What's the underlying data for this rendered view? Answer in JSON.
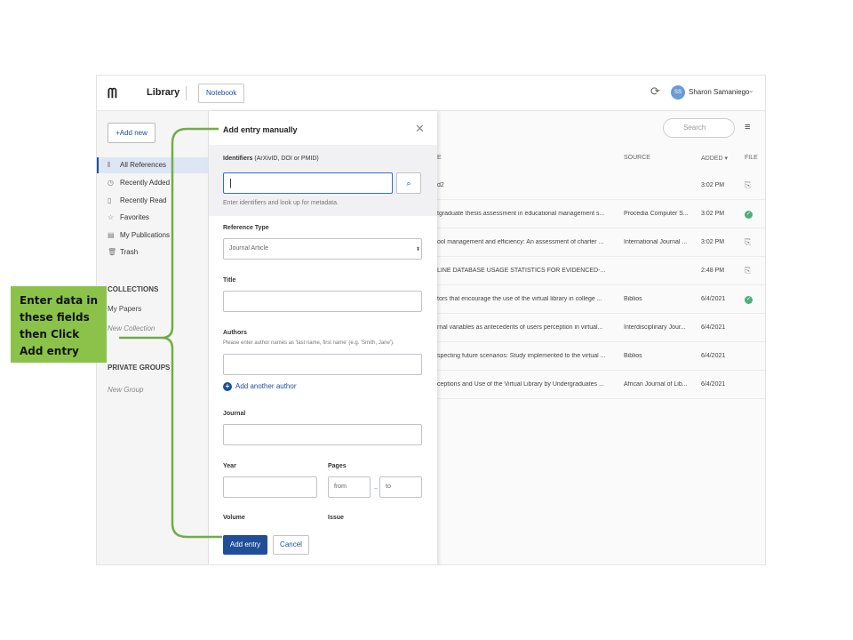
{
  "topbar": {
    "logo": "ᗰ",
    "title": "Library",
    "notebook_label": "Notebook",
    "avatar_initials": "SS",
    "user_name": "Sharon Samaniego"
  },
  "sidebar": {
    "add_new_label": "+Add new",
    "items": [
      {
        "icon": "all-references-icon",
        "glyph": "⫴",
        "label": "All References"
      },
      {
        "icon": "clock-icon",
        "glyph": "◷",
        "label": "Recently Added"
      },
      {
        "icon": "bookmark-icon",
        "glyph": "▯",
        "label": "Recently Read"
      },
      {
        "icon": "star-icon",
        "glyph": "☆",
        "label": "Favorites"
      },
      {
        "icon": "publications-icon",
        "glyph": "▤",
        "label": "My Publications"
      },
      {
        "icon": "trash-icon",
        "glyph": "🗑",
        "label": "Trash"
      }
    ],
    "collections_heading": "COLLECTIONS",
    "my_papers": "My Papers",
    "new_collection": "New Collection",
    "private_groups_heading": "PRIVATE GROUPS",
    "new_group": "New Group"
  },
  "list": {
    "search_placeholder": "Search",
    "headers": {
      "title": "E",
      "source": "SOURCE",
      "added": "ADDED ▾",
      "file": "FILE"
    },
    "rows": [
      {
        "title": "d2",
        "source": "",
        "added": "3:02 PM",
        "file": "attach"
      },
      {
        "title": "tgraduate thesis assessment in educational management s...",
        "source": "Procedia Computer S...",
        "added": "3:02 PM",
        "file": "ok"
      },
      {
        "title": "ool management and efficiency: An assessment of charter ...",
        "source": "International Journal ...",
        "added": "3:02 PM",
        "file": "attach"
      },
      {
        "title": "LINE DATABASE USAGE STATISTICS FOR EVIDENCED-...",
        "source": "",
        "added": "2:48 PM",
        "file": "attach"
      },
      {
        "title": "tors that encourage the use of the virtual library in college ...",
        "source": "Biblios",
        "added": "6/4/2021",
        "file": "ok"
      },
      {
        "title": "rnal variables as antecedents of users perception in virtual...",
        "source": "Interdisciplinary Jour...",
        "added": "6/4/2021",
        "file": ""
      },
      {
        "title": "specting future scenarios: Study implemented to the virtual ...",
        "source": "Biblios",
        "added": "6/4/2021",
        "file": ""
      },
      {
        "title": "ceptions and Use of the Virtual Library by Undergraduates ...",
        "source": "African Journal of Lib...",
        "added": "6/4/2021",
        "file": ""
      }
    ]
  },
  "panel": {
    "title": "Add entry manually",
    "identifiers_label": "Identifiers",
    "identifiers_sub": "(ArXivID, DOI or PMID)",
    "identifiers_help": "Enter identifiers and look up for metadata.",
    "reference_type_label": "Reference Type",
    "reference_type_value": "Journal Article",
    "title_label": "Title",
    "authors_label": "Authors",
    "authors_help": "Please enter author names as 'last name, first name' (e.g. 'Smith, Jane').",
    "add_author": "Add another author",
    "journal_label": "Journal",
    "year_label": "Year",
    "pages_label": "Pages",
    "pages_from": "from",
    "pages_to": "to",
    "pages_dash": "–",
    "volume_label": "Volume",
    "issue_label": "Issue",
    "add_entry": "Add entry",
    "cancel": "Cancel"
  },
  "callout": {
    "lines": [
      "Enter data in",
      "these fields",
      "then Click",
      "Add entry"
    ],
    "color": "#8bc34a"
  }
}
